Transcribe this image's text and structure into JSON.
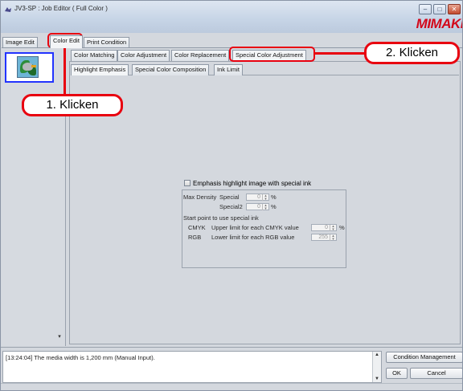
{
  "window": {
    "title": "JV3-SP : Job Editor ( Full Color )",
    "brand": "Mimaki",
    "controls": [
      "–",
      "□",
      "✕"
    ]
  },
  "top_tabs": [
    {
      "label": "Image Edit"
    },
    {
      "label": "Color Edit",
      "active": true
    },
    {
      "label": "Print Condition"
    }
  ],
  "color_tabs": [
    {
      "label": "Color Matching"
    },
    {
      "label": "Color Adjustment"
    },
    {
      "label": "Color Replacement"
    },
    {
      "label": "Special Color Adjustment",
      "active": true
    }
  ],
  "special_tabs": [
    {
      "label": "Highlight Emphasis",
      "active": true
    },
    {
      "label": "Special Color Composition"
    },
    {
      "label": "Ink Limit"
    }
  ],
  "highlight": {
    "checkbox_label": "Emphasis highlight image with special ink",
    "max_density_label": "Max Density",
    "special_label": "Special",
    "special_value": "0",
    "special2_label": "Special2",
    "special2_value": "0",
    "percent": "%",
    "start_point_label": "Start point to use special ink",
    "cmyk_label": "CMYK",
    "cmyk_desc": "Upper limit for each CMYK value",
    "cmyk_value": "0",
    "rgb_label": "RGB",
    "rgb_desc": "Lower limit for each RGB value",
    "rgb_value": "255"
  },
  "log": {
    "message": "[13:24:04] The media width is 1,200 mm (Manual Input)."
  },
  "buttons": {
    "condition_management": "Condition Management",
    "ok": "OK",
    "cancel": "Cancel"
  },
  "annotations": {
    "step1": "1. Klicken",
    "step2": "2. Klicken",
    "color": "#e8000f"
  }
}
